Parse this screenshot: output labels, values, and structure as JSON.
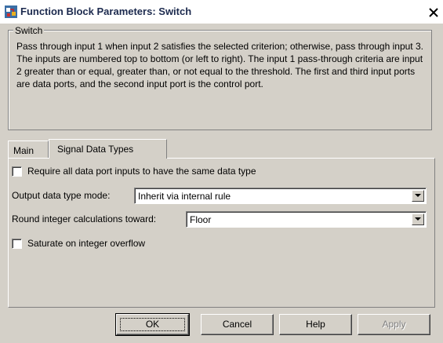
{
  "window": {
    "title": "Function Block Parameters: Switch",
    "close_symbol": "X"
  },
  "group": {
    "legend": "Switch",
    "description": "Pass through input 1 when input 2 satisfies the selected criterion; otherwise, pass through input 3.  The inputs are numbered top to bottom (or left to right). The input 1 pass-through criteria are input 2 greater than or equal, greater than, or not equal to the threshold.  The first and third input ports are data ports, and the second input port is the control port."
  },
  "tabs": [
    {
      "label": "Main",
      "active": false
    },
    {
      "label": "Signal Data Types",
      "active": true
    }
  ],
  "panel": {
    "require_same_type": {
      "label": "Require all data port inputs to have the same data type",
      "checked": false
    },
    "output_mode": {
      "label": "Output data type mode:",
      "value": "Inherit via internal rule"
    },
    "rounding": {
      "label": "Round integer calculations toward:",
      "value": "Floor"
    },
    "saturate": {
      "label": "Saturate on integer overflow",
      "checked": false
    }
  },
  "buttons": {
    "ok": "OK",
    "cancel": "Cancel",
    "help": "Help",
    "apply": "Apply"
  },
  "icons": {
    "app": "simulink-block-icon",
    "close": "close-icon",
    "dropdown": "chevron-down-icon"
  }
}
